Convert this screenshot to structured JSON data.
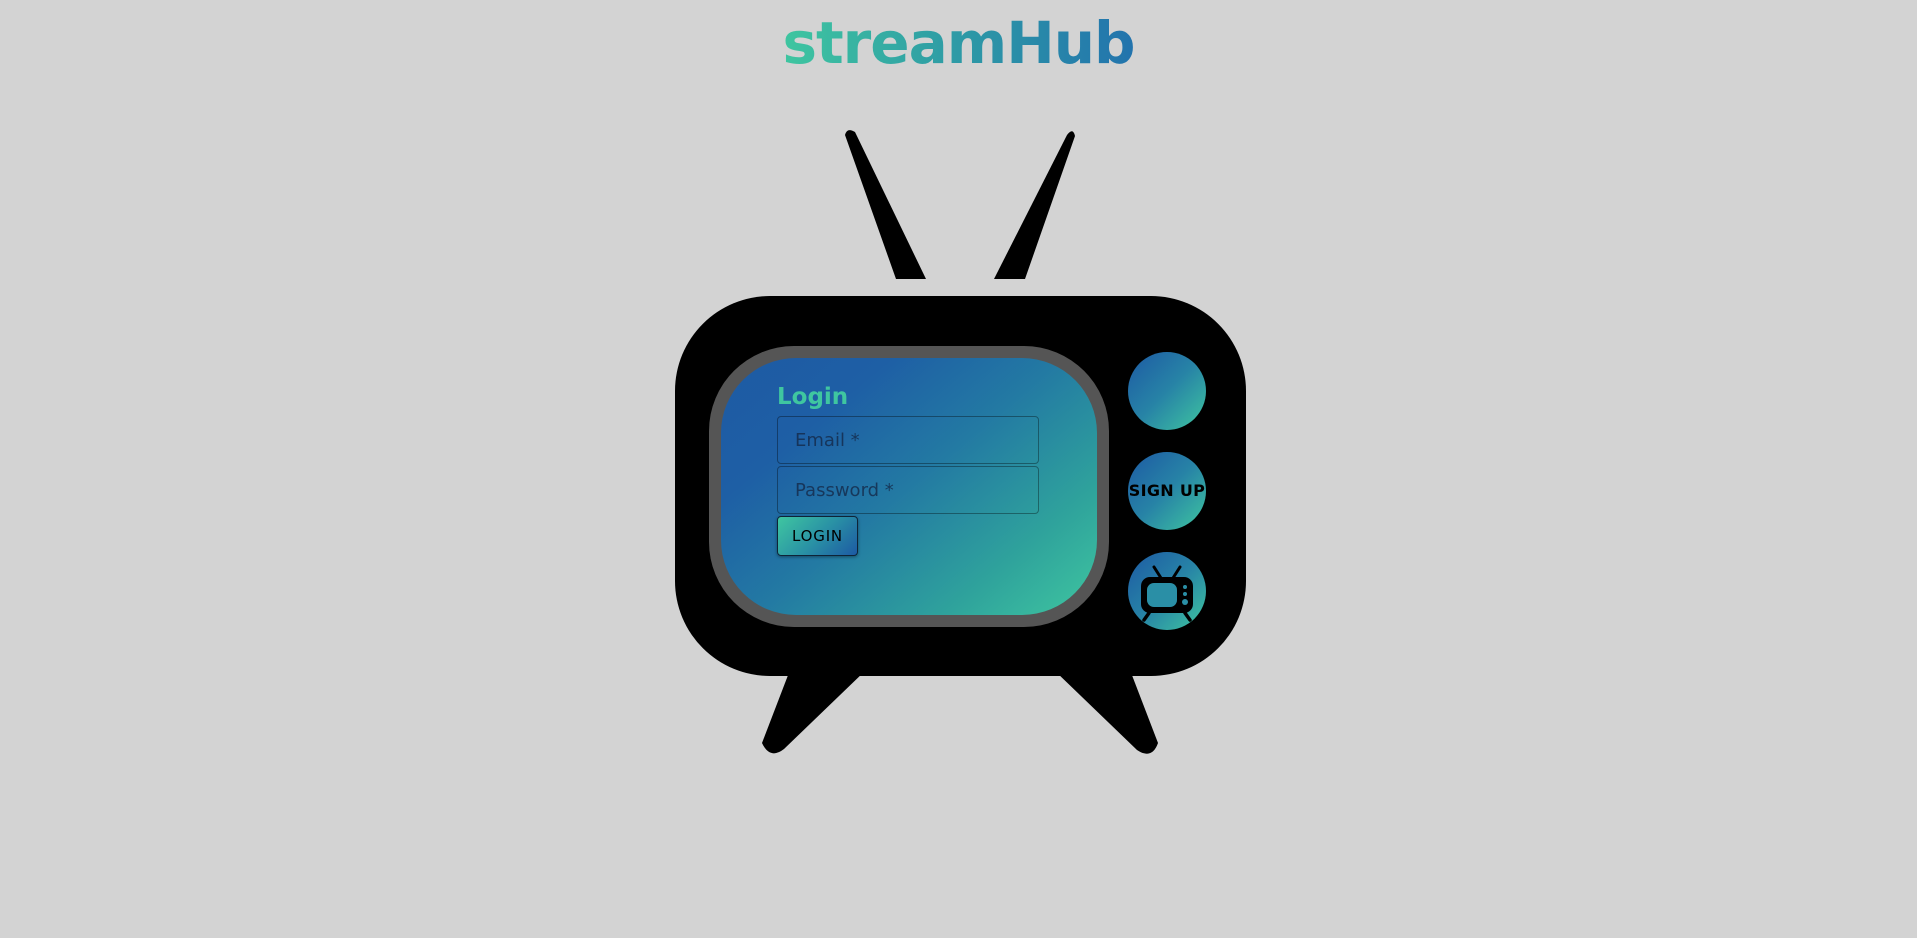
{
  "header": {
    "brand": "streamHub"
  },
  "login_form": {
    "title": "Login",
    "email_placeholder": "Email *",
    "password_placeholder": "Password *",
    "login_button_label": "LOGIN"
  },
  "side_buttons": {
    "signup_label": "SIGN UP"
  },
  "colors": {
    "background": "#d3d3d3",
    "gradient_start": "#1d5aa4",
    "gradient_end": "#3fc6a0",
    "tv_body": "#000000",
    "screen_bezel": "#555555"
  },
  "icons": [
    "tv-icon"
  ]
}
